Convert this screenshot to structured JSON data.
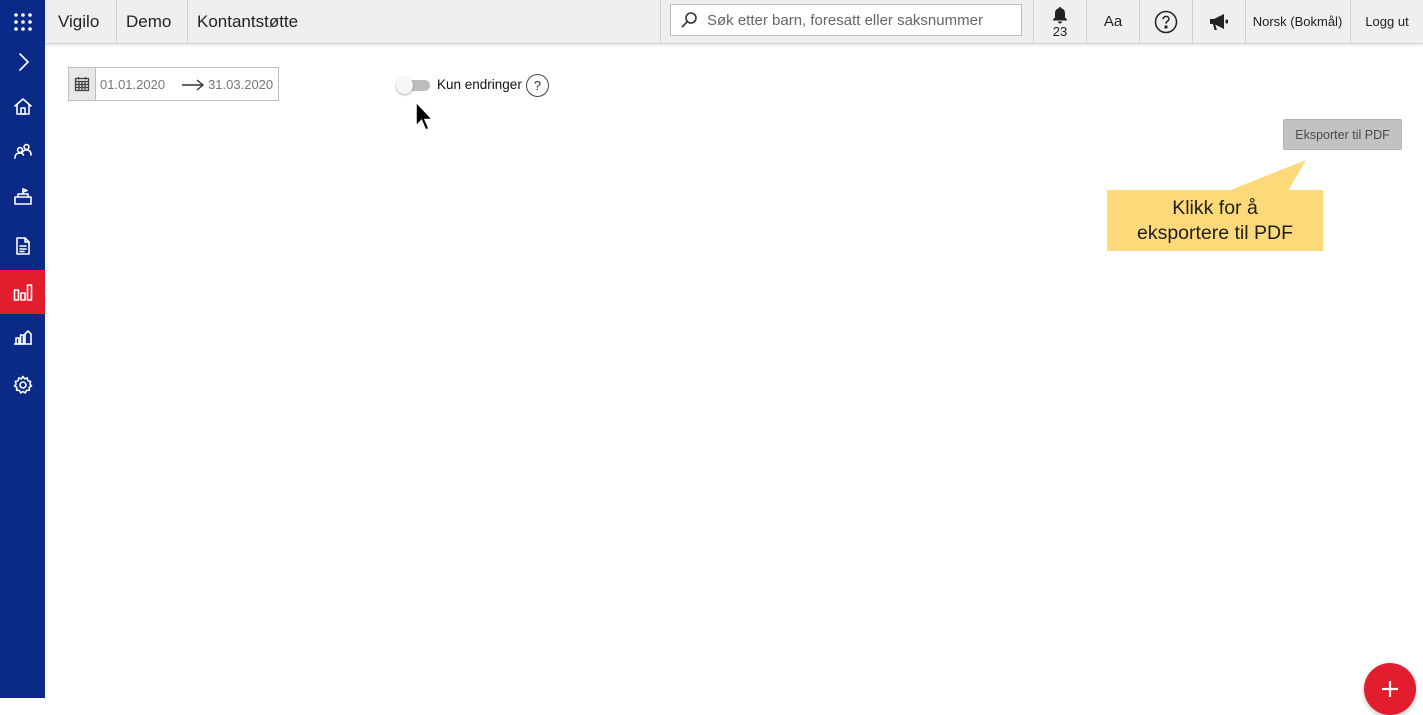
{
  "topbar": {
    "app_name": "Vigilo",
    "org_name": "Demo",
    "module_name": "Kontantstøtte",
    "search": {
      "placeholder": "Søk etter barn, foresatt eller saksnummer",
      "value": ""
    },
    "notifications": {
      "count": "23"
    },
    "font_size_label": "Aa",
    "language": "Norsk (Bokmål)",
    "logout_label": "Logg ut"
  },
  "sidebar": {
    "items": [
      {
        "icon": "apps-grid-icon"
      },
      {
        "icon": "chevron-right-icon"
      },
      {
        "icon": "home-icon"
      },
      {
        "icon": "people-icon"
      },
      {
        "icon": "school-icon"
      },
      {
        "icon": "document-icon"
      },
      {
        "icon": "bar-chart-icon",
        "active": true
      },
      {
        "icon": "building-chart-icon"
      },
      {
        "icon": "gear-icon"
      }
    ],
    "active_color": "#e11d2e",
    "background_color": "#0b2a87"
  },
  "filters": {
    "date_from": "01.01.2020",
    "date_to": "31.03.2020",
    "only_changes_label": "Kun endringer",
    "only_changes_enabled": false,
    "help_glyph": "?"
  },
  "actions": {
    "export_pdf_label": "Eksporter til PDF"
  },
  "callout": {
    "text_line1": "Klikk for å",
    "text_line2": "eksportere til PDF",
    "color": "#fed97a"
  },
  "fab": {
    "icon": "plus-icon",
    "color": "#e11d2e"
  }
}
